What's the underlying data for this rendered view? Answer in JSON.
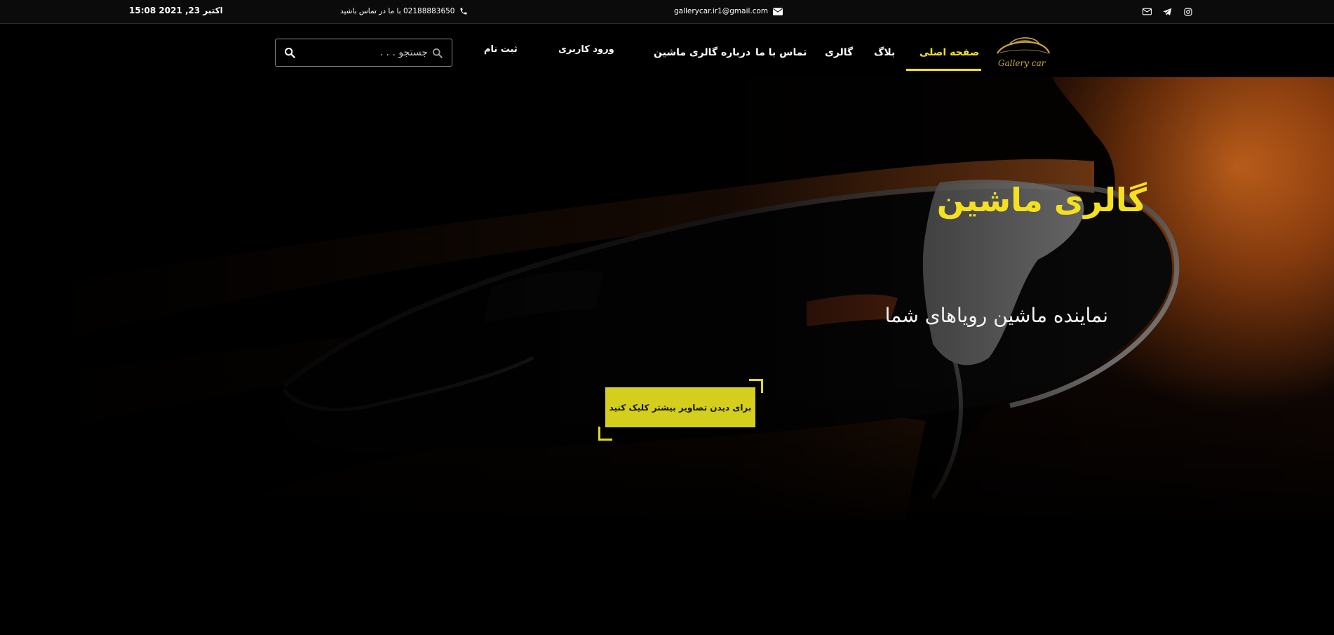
{
  "topbar": {
    "date": "اکتبر 23, 2021 15:08",
    "phone": "02188883650 با ما در تماس باشید",
    "email": "gallerycar.ir1@gmail.com",
    "social_icons": [
      "email-icon",
      "telegram-icon",
      "instagram-icon"
    ]
  },
  "header": {
    "logo_text": "Gallery car",
    "search_placeholder": "جستجو . . .",
    "signup": "ثبت نام",
    "login": "ورود کاربری",
    "nav": {
      "home": "صفحه اصلی",
      "blog": "بلاگ",
      "gallery": "گالری",
      "contact": "تماس با ما",
      "about": "درباره گالری ماشین"
    },
    "active_nav": "home"
  },
  "hero": {
    "title": "گالری ماشین",
    "subtitle": "نماینده ماشین رویاهای شما",
    "cta": "برای دیدن تصاویر بیشتر کلیک کنید"
  },
  "colors": {
    "accent": "#f5e020",
    "cta_bg": "#d3cf1c",
    "background": "#000000"
  }
}
